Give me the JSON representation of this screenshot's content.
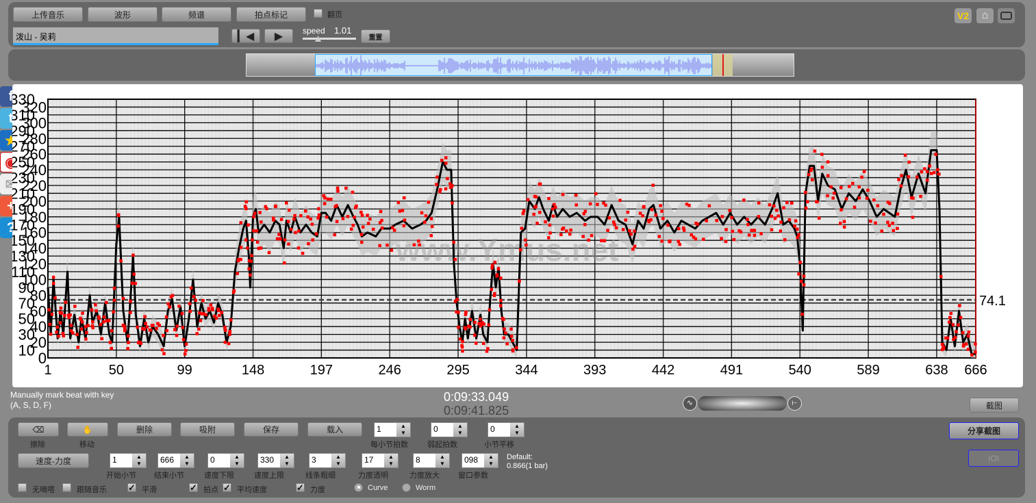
{
  "toolbar": {
    "upload": "上传音乐",
    "waveform": "波形",
    "spectrum": "频谱",
    "beat_mark": "拍点标记",
    "page_turn": "翻页",
    "song": "泼山 - 吴莉",
    "speed_label": "speed",
    "speed_value": "1.01",
    "reset": "重置",
    "v2": "V2"
  },
  "status": {
    "hint1": "Manually mark beat with key",
    "hint2": "(A, S, D, F)",
    "time_current": "0:09:33.049",
    "time_total": "0:09:41.825",
    "screenshot": "截图",
    "share_screenshot": "分享截图",
    "ioi": "IOI"
  },
  "controls": {
    "buttons": [
      {
        "label": "擦除",
        "icon": "eraser-icon"
      },
      {
        "label": "移动",
        "icon": "hand-icon"
      },
      {
        "label": "删除"
      },
      {
        "label": "吸附"
      },
      {
        "label": "保存"
      },
      {
        "label": "载入"
      }
    ],
    "top_spinners": [
      {
        "label": "每小节拍数",
        "value": "1"
      },
      {
        "label": "弱起拍数",
        "value": "0"
      },
      {
        "label": "小节平移",
        "value": "0"
      }
    ],
    "mode": "速度-力度",
    "spinners": [
      {
        "label": "开始小节",
        "value": "1"
      },
      {
        "label": "结束小节",
        "value": "666"
      },
      {
        "label": "速度下限",
        "value": "0"
      },
      {
        "label": "速度上限",
        "value": "330"
      },
      {
        "label": "线条粗细",
        "value": "3"
      },
      {
        "label": "力度透明",
        "value": "17"
      },
      {
        "label": "力度放大",
        "value": "8"
      },
      {
        "label": "窗口参数",
        "value": "098"
      }
    ],
    "default_label": "Default:",
    "default_value": "0.866(1 bar)",
    "checks": [
      {
        "label": "无嘀嗒",
        "checked": false
      },
      {
        "label": "跟随音乐",
        "checked": false
      },
      {
        "label": "平滑",
        "checked": true
      },
      {
        "label": "拍点",
        "checked": true
      },
      {
        "label": "平均速度",
        "checked": true
      },
      {
        "label": "力度",
        "checked": true
      }
    ],
    "radios": [
      {
        "label": "Curve",
        "selected": true
      },
      {
        "label": "Worm",
        "selected": false
      }
    ]
  },
  "chart_data": {
    "type": "line",
    "xlim": [
      1,
      666
    ],
    "ylim": [
      0,
      330
    ],
    "x_ticks": [
      1,
      50,
      99,
      148,
      197,
      246,
      295,
      344,
      393,
      442,
      491,
      540,
      589,
      638,
      666
    ],
    "y_ticks": [
      0,
      10,
      20,
      30,
      40,
      50,
      60,
      70,
      80,
      90,
      100,
      110,
      120,
      130,
      140,
      150,
      160,
      170,
      180,
      190,
      200,
      210,
      220,
      230,
      240,
      250,
      260,
      270,
      280,
      290,
      300,
      310,
      320,
      330
    ],
    "average": 74.1,
    "average_label": "74.1",
    "watermark": "www.Ymus.net",
    "colors": {
      "curve": "#000000",
      "beats": "#ff0000",
      "band": "#bbbbbb",
      "average": "#444444"
    },
    "tempo_curve": [
      [
        1,
        90
      ],
      [
        3,
        30
      ],
      [
        5,
        100
      ],
      [
        8,
        25
      ],
      [
        10,
        60
      ],
      [
        12,
        30
      ],
      [
        15,
        110
      ],
      [
        17,
        25
      ],
      [
        20,
        55
      ],
      [
        23,
        20
      ],
      [
        25,
        50
      ],
      [
        28,
        25
      ],
      [
        31,
        80
      ],
      [
        33,
        45
      ],
      [
        36,
        60
      ],
      [
        39,
        30
      ],
      [
        42,
        70
      ],
      [
        45,
        30
      ],
      [
        47,
        20
      ],
      [
        50,
        145
      ],
      [
        52,
        180
      ],
      [
        55,
        60
      ],
      [
        58,
        20
      ],
      [
        60,
        70
      ],
      [
        62,
        130
      ],
      [
        64,
        55
      ],
      [
        67,
        15
      ],
      [
        70,
        50
      ],
      [
        73,
        20
      ],
      [
        76,
        40
      ],
      [
        80,
        30
      ],
      [
        84,
        15
      ],
      [
        87,
        60
      ],
      [
        90,
        75
      ],
      [
        93,
        35
      ],
      [
        96,
        65
      ],
      [
        99,
        15
      ],
      [
        102,
        50
      ],
      [
        105,
        100
      ],
      [
        108,
        40
      ],
      [
        111,
        70
      ],
      [
        114,
        50
      ],
      [
        117,
        60
      ],
      [
        120,
        45
      ],
      [
        123,
        70
      ],
      [
        126,
        55
      ],
      [
        129,
        20
      ],
      [
        132,
        40
      ],
      [
        135,
        110
      ],
      [
        138,
        140
      ],
      [
        141,
        165
      ],
      [
        143,
        175
      ],
      [
        145,
        130
      ],
      [
        146,
        90
      ],
      [
        148,
        180
      ],
      [
        150,
        190
      ],
      [
        152,
        160
      ],
      [
        156,
        170
      ],
      [
        160,
        160
      ],
      [
        164,
        175
      ],
      [
        167,
        170
      ],
      [
        170,
        140
      ],
      [
        172,
        175
      ],
      [
        175,
        160
      ],
      [
        178,
        180
      ],
      [
        182,
        160
      ],
      [
        186,
        170
      ],
      [
        190,
        160
      ],
      [
        194,
        155
      ],
      [
        197,
        185
      ],
      [
        200,
        185
      ],
      [
        204,
        175
      ],
      [
        208,
        195
      ],
      [
        212,
        180
      ],
      [
        216,
        195
      ],
      [
        220,
        180
      ],
      [
        223,
        170
      ],
      [
        226,
        155
      ],
      [
        230,
        160
      ],
      [
        236,
        155
      ],
      [
        240,
        165
      ],
      [
        246,
        165
      ],
      [
        250,
        170
      ],
      [
        256,
        175
      ],
      [
        262,
        165
      ],
      [
        268,
        170
      ],
      [
        272,
        175
      ],
      [
        276,
        185
      ],
      [
        280,
        215
      ],
      [
        284,
        250
      ],
      [
        287,
        240
      ],
      [
        290,
        240
      ],
      [
        292,
        120
      ],
      [
        294,
        70
      ],
      [
        296,
        40
      ],
      [
        298,
        20
      ],
      [
        300,
        50
      ],
      [
        302,
        25
      ],
      [
        305,
        60
      ],
      [
        308,
        25
      ],
      [
        311,
        55
      ],
      [
        313,
        30
      ],
      [
        316,
        20
      ],
      [
        318,
        75
      ],
      [
        320,
        120
      ],
      [
        322,
        90
      ],
      [
        324,
        115
      ],
      [
        326,
        60
      ],
      [
        328,
        30
      ],
      [
        331,
        30
      ],
      [
        334,
        20
      ],
      [
        337,
        10
      ],
      [
        340,
        160
      ],
      [
        343,
        165
      ],
      [
        346,
        200
      ],
      [
        350,
        190
      ],
      [
        353,
        205
      ],
      [
        356,
        190
      ],
      [
        360,
        175
      ],
      [
        363,
        195
      ],
      [
        366,
        180
      ],
      [
        370,
        190
      ],
      [
        375,
        180
      ],
      [
        380,
        185
      ],
      [
        386,
        175
      ],
      [
        390,
        180
      ],
      [
        395,
        180
      ],
      [
        400,
        170
      ],
      [
        405,
        195
      ],
      [
        410,
        175
      ],
      [
        415,
        170
      ],
      [
        420,
        145
      ],
      [
        424,
        175
      ],
      [
        428,
        165
      ],
      [
        432,
        190
      ],
      [
        435,
        195
      ],
      [
        440,
        165
      ],
      [
        445,
        175
      ],
      [
        450,
        160
      ],
      [
        455,
        175
      ],
      [
        460,
        170
      ],
      [
        465,
        165
      ],
      [
        470,
        175
      ],
      [
        480,
        185
      ],
      [
        485,
        170
      ],
      [
        490,
        185
      ],
      [
        495,
        170
      ],
      [
        500,
        180
      ],
      [
        505,
        170
      ],
      [
        510,
        180
      ],
      [
        515,
        170
      ],
      [
        520,
        190
      ],
      [
        524,
        210
      ],
      [
        528,
        170
      ],
      [
        532,
        175
      ],
      [
        536,
        165
      ],
      [
        538,
        155
      ],
      [
        540,
        120
      ],
      [
        542,
        35
      ],
      [
        544,
        210
      ],
      [
        547,
        245
      ],
      [
        550,
        245
      ],
      [
        553,
        200
      ],
      [
        556,
        235
      ],
      [
        560,
        220
      ],
      [
        565,
        215
      ],
      [
        570,
        190
      ],
      [
        575,
        210
      ],
      [
        580,
        200
      ],
      [
        585,
        215
      ],
      [
        590,
        200
      ],
      [
        595,
        180
      ],
      [
        600,
        190
      ],
      [
        604,
        185
      ],
      [
        608,
        180
      ],
      [
        612,
        215
      ],
      [
        616,
        240
      ],
      [
        620,
        205
      ],
      [
        625,
        235
      ],
      [
        630,
        210
      ],
      [
        634,
        265
      ],
      [
        638,
        265
      ],
      [
        640,
        190
      ],
      [
        642,
        20
      ],
      [
        645,
        10
      ],
      [
        648,
        50
      ],
      [
        651,
        15
      ],
      [
        654,
        60
      ],
      [
        657,
        20
      ],
      [
        660,
        30
      ],
      [
        663,
        5
      ],
      [
        666,
        5
      ]
    ]
  }
}
